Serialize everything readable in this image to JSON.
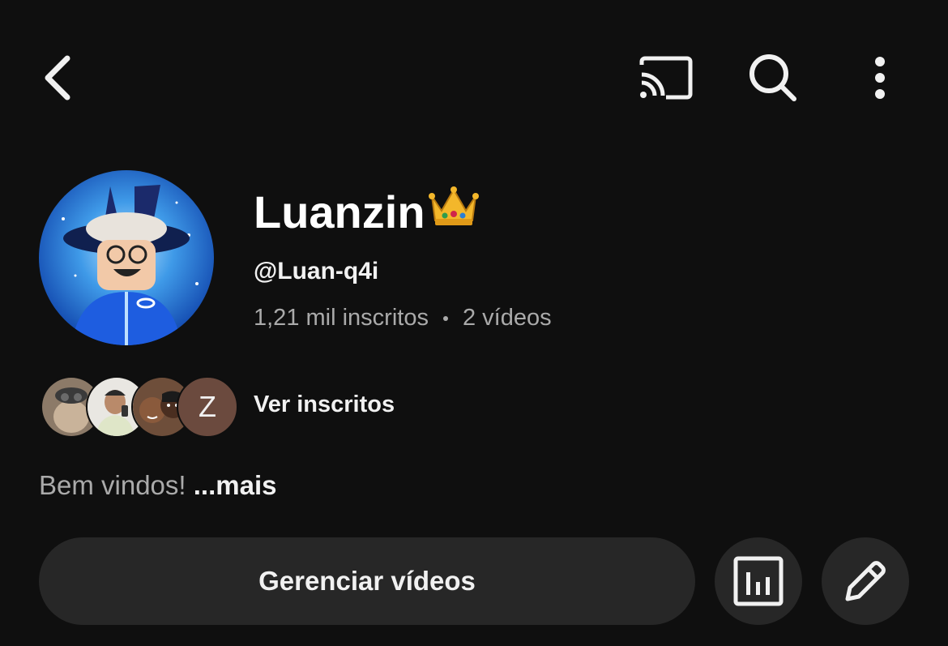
{
  "header": {
    "back_icon": "chevron-left-icon",
    "cast_icon": "cast-icon",
    "search_icon": "search-icon",
    "more_icon": "more-vertical-icon"
  },
  "channel": {
    "name": "Luanzin",
    "name_emoji": "crown-emoji",
    "handle": "@Luan-q4i",
    "subscribers": "1,21 mil inscritos",
    "videos": "2 vídeos",
    "description": "Bem vindos!",
    "more_label": "...mais"
  },
  "subscribers_preview": {
    "last_initial": "Z",
    "label": "Ver inscritos"
  },
  "actions": {
    "manage_label": "Gerenciar vídeos",
    "analytics_icon": "analytics-icon",
    "edit_icon": "pencil-icon"
  },
  "colors": {
    "background": "#0f0f0f",
    "button_bg": "#272727",
    "primary_text": "#f1f1f1",
    "secondary_text": "#aaaaaa"
  }
}
